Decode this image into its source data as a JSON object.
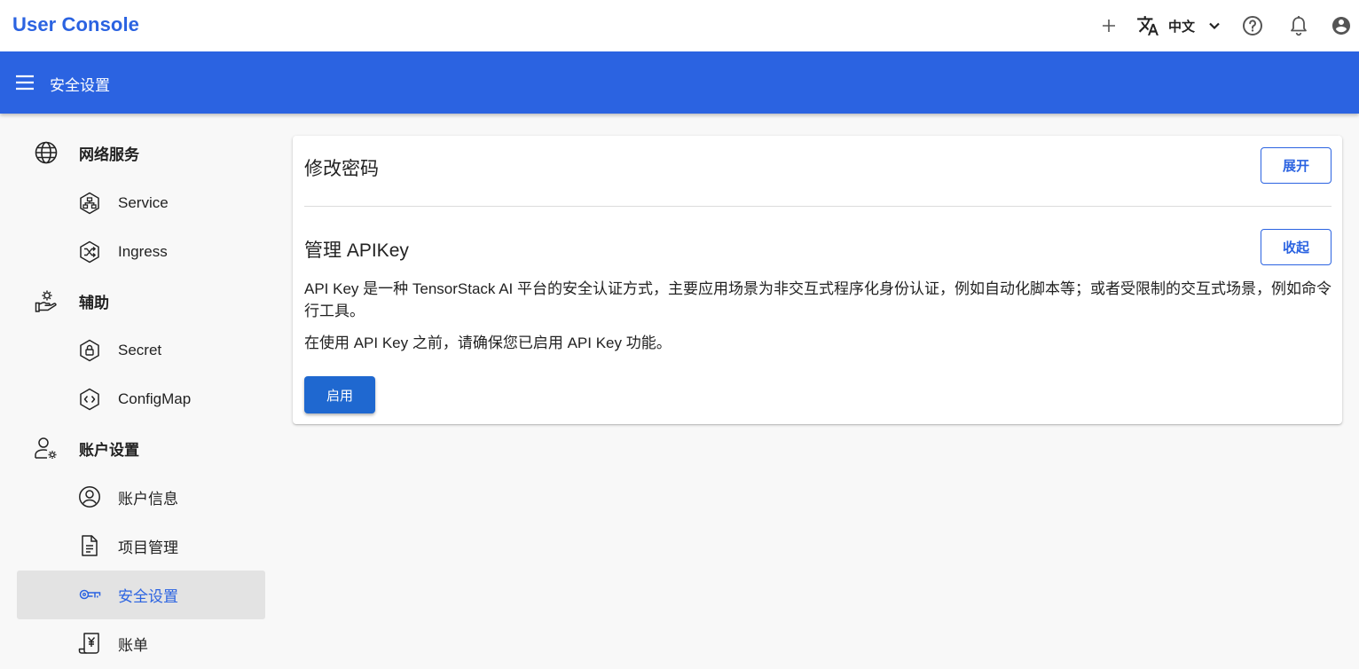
{
  "app": {
    "title": "User Console"
  },
  "topbar": {
    "language": "中文",
    "icons": [
      "plus-icon",
      "translate-icon",
      "chevron-down-icon",
      "help-icon",
      "bell-icon",
      "account-icon"
    ]
  },
  "header": {
    "title": "安全设置"
  },
  "sidebar": {
    "groups": [
      {
        "label": "网络服务",
        "icon": "globe-icon",
        "items": [
          {
            "label": "Service",
            "icon": "service-icon"
          },
          {
            "label": "Ingress",
            "icon": "ingress-icon"
          }
        ]
      },
      {
        "label": "辅助",
        "icon": "hand-gear-icon",
        "items": [
          {
            "label": "Secret",
            "icon": "secret-icon"
          },
          {
            "label": "ConfigMap",
            "icon": "configmap-icon"
          }
        ]
      },
      {
        "label": "账户设置",
        "icon": "user-gear-icon",
        "items": [
          {
            "label": "账户信息",
            "icon": "account-circle-icon"
          },
          {
            "label": "项目管理",
            "icon": "document-icon"
          },
          {
            "label": "安全设置",
            "icon": "key-icon",
            "active": true
          },
          {
            "label": "账单",
            "icon": "bill-icon"
          }
        ]
      }
    ]
  },
  "main": {
    "change_password": {
      "title": "修改密码",
      "toggle_label": "展开"
    },
    "api_key": {
      "title": "管理 APIKey",
      "toggle_label": "收起",
      "description": "API Key 是一种 TensorStack AI 平台的安全认证方式，主要应用场景为非交互式程序化身份认证，例如自动化脚本等；或者受限制的交互式场景，例如命令行工具。",
      "notice": "在使用 API Key 之前，请确保您已启用 API Key 功能。",
      "enable_label": "启用"
    }
  },
  "colors": {
    "brand": "#2b63e1",
    "primary_button": "#1f68d0",
    "active_bg": "#e3e3e3"
  }
}
